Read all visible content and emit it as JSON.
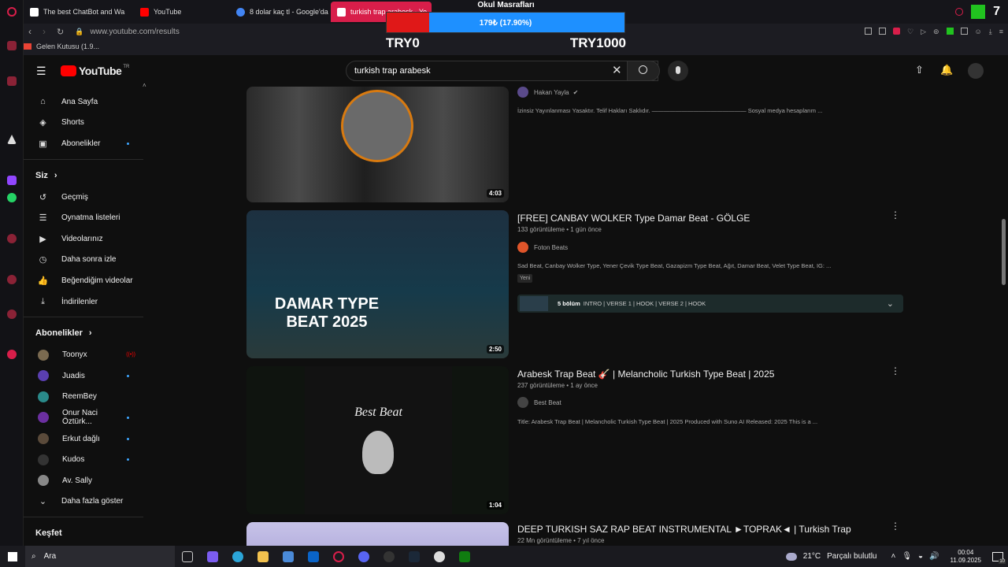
{
  "browser": {
    "tabs": [
      {
        "label": "The best ChatBot and Wa",
        "color": "#ffffff"
      },
      {
        "label": "YouTube",
        "color": "#ff0000"
      },
      {
        "label": "8 dolar kaç tl - Google'da",
        "color": "#4285f4"
      },
      {
        "label": "turkish trap arabesk - Yo",
        "color": "#ff0000"
      }
    ],
    "url": "www.youtube.com/results",
    "bookmark": "Gelen Kutusu (1.9..."
  },
  "overlay": {
    "title": "Okul Masrafları",
    "progress_text": "179₺ (17.90%)",
    "progress_fraction": 0.179,
    "min_label": "TRY0",
    "max_label": "TRY1000",
    "fill_color": "#e01818",
    "bar_color": "#1e90ff"
  },
  "header": {
    "logo_text": "YouTube",
    "logo_sup": "TR",
    "search_value": "turkish trap arabesk"
  },
  "sidebar": {
    "main": [
      {
        "label": "Ana Sayfa",
        "icon": "home-icon"
      },
      {
        "label": "Shorts",
        "icon": "shorts-icon"
      },
      {
        "label": "Abonelikler",
        "icon": "subscriptions-icon",
        "dot": true
      }
    ],
    "you_title": "Siz",
    "you": [
      {
        "label": "Geçmiş",
        "icon": "history-icon"
      },
      {
        "label": "Oynatma listeleri",
        "icon": "playlists-icon"
      },
      {
        "label": "Videolarınız",
        "icon": "your-videos-icon"
      },
      {
        "label": "Daha sonra izle",
        "icon": "watch-later-icon"
      },
      {
        "label": "Beğendiğim videolar",
        "icon": "liked-icon"
      },
      {
        "label": "İndirilenler",
        "icon": "download-icon"
      }
    ],
    "subs_title": "Abonelikler",
    "subs": [
      {
        "label": "Toonyx",
        "color": "#7a6a50",
        "live": true
      },
      {
        "label": "Juadis",
        "color": "#5a3fb0",
        "dot": true
      },
      {
        "label": "ReemBey",
        "color": "#2a8a8a"
      },
      {
        "label": "Onur Naci Öztürk...",
        "color": "#6b2fa0",
        "dot": true
      },
      {
        "label": "Erkut dağlı",
        "color": "#5a4a3a",
        "dot": true
      },
      {
        "label": "Kudos",
        "color": "#333333",
        "dot": true
      },
      {
        "label": "Av. Sally",
        "color": "#888888"
      }
    ],
    "show_more": "Daha fazla göster",
    "explore_title": "Keşfet"
  },
  "results": [
    {
      "channel": "Hakan Yayla",
      "verified": true,
      "desc": "İzinsiz Yayınlanması Yasaktır. Telif Hakları Saklıdır. ———————————————— Sosyal medya hesaplarım ...",
      "duration": "4:03"
    },
    {
      "title": "[FREE] CANBAY WOLKER Type Damar Beat - GÖLGE",
      "meta": "133 görüntüleme • 1 gün önce",
      "channel": "Foton Beats",
      "desc": "Sad Beat, Canbay Wolker Type, Yener Çevik Type Beat, Gazapizm Type Beat, Ağıt, Damar Beat, Velet Type Beat, IG: ...",
      "badge": "Yeni",
      "chapters_count": "5 bölüm",
      "chapters_list": "INTRO | VERSE 1 | HOOK | VERSE 2 | HOOK",
      "thumb_text": "DAMAR TYPE BEAT 2025",
      "duration": "2:50"
    },
    {
      "title": "Arabesk Trap Beat 🎸 | Melancholic Turkish Type Beat | 2025",
      "meta": "237 görüntüleme • 1 ay önce",
      "channel": "Best Beat",
      "desc": "Title: Arabesk Trap Beat | Melancholic Turkish Type Beat | 2025 Produced with Suno AI Released: 2025 This is a ...",
      "thumb_text": "Best Beat",
      "duration": "1:04"
    },
    {
      "title": "DEEP TURKISH SAZ RAP BEAT INSTRUMENTAL ►TOPRAK◄ | Turkish Trap",
      "meta": "22 Mn görüntüleme • 7 yıl önce"
    }
  ],
  "taskbar": {
    "search": "Ara",
    "weather": "21°C",
    "weather_desc": "Parçalı bulutlu",
    "time": "00:04",
    "date": "11.09.2025",
    "notif": "10"
  }
}
